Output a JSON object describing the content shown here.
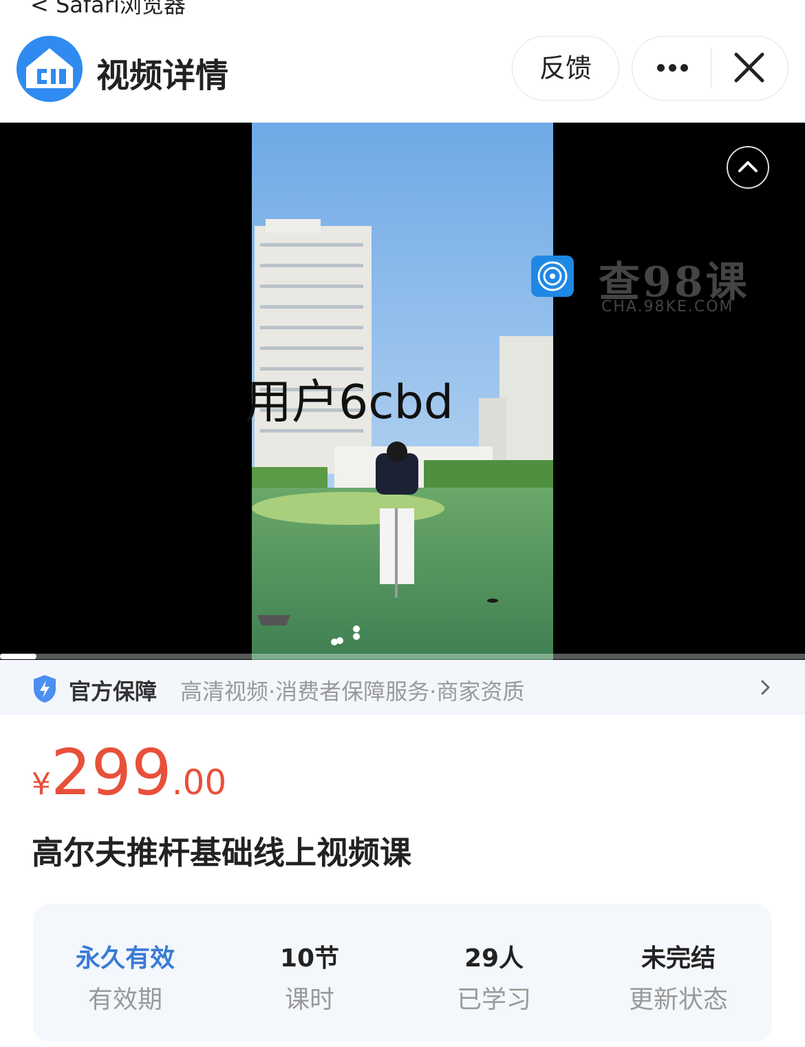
{
  "top_bar": {
    "back_label": "< Safari浏览器"
  },
  "header": {
    "title": "视频详情",
    "feedback_label": "反馈"
  },
  "video": {
    "overlay_user_text": "用户6cbd",
    "watermark_main": "查98课",
    "watermark_sub": "CHA.98KE.COM",
    "progress_fraction": 0.045
  },
  "guarantee": {
    "title": "官方保障",
    "items": "高清视频·消费者保障服务·商家资质"
  },
  "price": {
    "symbol": "¥",
    "integer": "299",
    "decimal": ".00",
    "color": "#e8503a"
  },
  "course": {
    "title": "高尔夫推杆基础线上视频课"
  },
  "stats": [
    {
      "value": "永久有效",
      "label": "有效期"
    },
    {
      "value": "10节",
      "label": "课时"
    },
    {
      "value": "29人",
      "label": "已学习"
    },
    {
      "value": "未完结",
      "label": "更新状态"
    }
  ],
  "colors": {
    "accent_blue": "#3a7bd5",
    "logo_blue": "#2f8bf0"
  }
}
